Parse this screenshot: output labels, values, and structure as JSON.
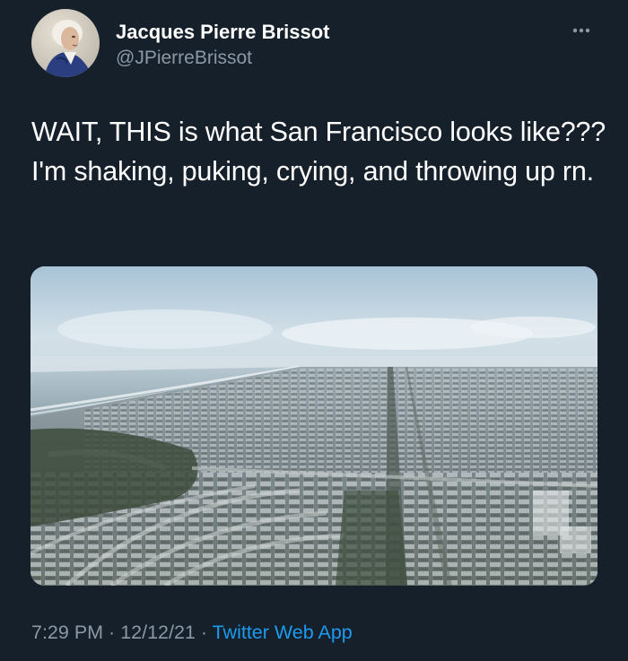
{
  "author": {
    "name": "Jacques Pierre Brissot",
    "handle": "@JPierreBrissot"
  },
  "tweet": {
    "text": "WAIT, THIS is what San Francisco looks like??? I'm shaking, puking, crying, and throwing up rn."
  },
  "meta": {
    "time": "7:29 PM",
    "separator_1": " · ",
    "date": "12/12/21",
    "separator_2": " · ",
    "source": "Twitter Web App"
  },
  "icons": {
    "more": "more-horizontal-icon"
  },
  "colors": {
    "background": "#15202b",
    "primary_text": "#ffffff",
    "secondary_text": "#8b98a5",
    "link": "#1d9bf0"
  }
}
